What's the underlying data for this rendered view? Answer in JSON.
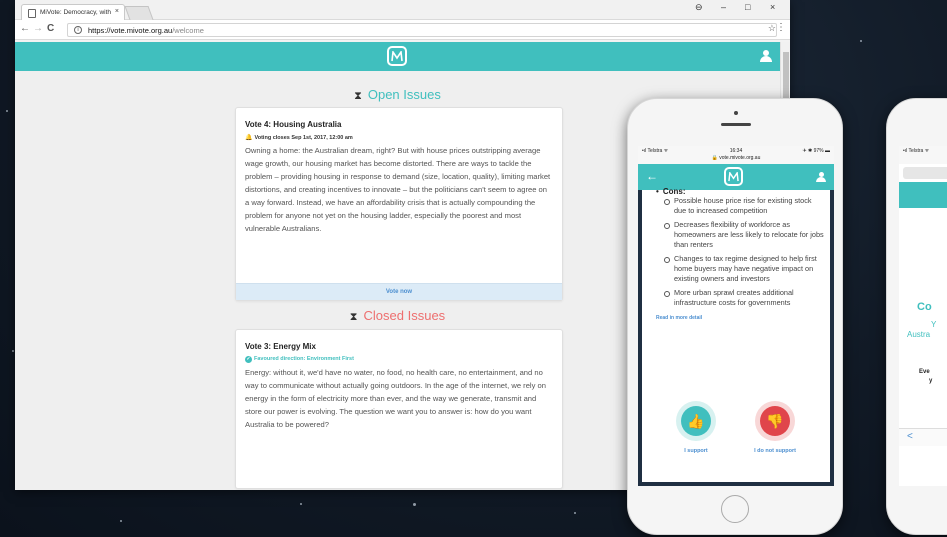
{
  "browser": {
    "tab_title": "MiVote: Democracy, with",
    "tab_close": "×",
    "window_controls": [
      "⊖",
      "–",
      "□",
      "×"
    ],
    "nav": {
      "back": "←",
      "forward": "→",
      "reload": "C"
    },
    "url_host": "https://vote.mivote.org.au",
    "url_path": "/welcome",
    "bookmark_icon": "☆",
    "menu_icon": "⋮"
  },
  "app": {
    "logo_icon": "mivote-logo",
    "user_icon": "user-icon",
    "accent_color": "#40bfbe",
    "danger_color": "#ee6f6f"
  },
  "open_issues": {
    "icon": "⧗",
    "title": "Open Issues",
    "card": {
      "title": "Vote 4: Housing Australia",
      "meta_icon": "bell-icon",
      "meta": "Voting closes Sep 1st, 2017, 12:00 am",
      "body": "Owning a home: the Australian dream, right? But with house prices outstripping average wage growth, our housing market has become distorted. There are ways to tackle the problem – providing housing in response to demand (size, location, quality), limiting market distortions, and creating incentives to innovate – but the politicians can't seem to agree on a way forward. Instead, we have an affordability crisis that is actually compounding the problem for anyone not yet on the housing ladder, especially the poorest and most vulnerable Australians.",
      "action": "Vote now"
    }
  },
  "closed_issues": {
    "icon": "⧗",
    "title": "Closed Issues",
    "card": {
      "title": "Vote 3: Energy Mix",
      "meta": "Favoured direction: Environment First",
      "body": "Energy: without it, we'd have no water, no food, no health care, no entertainment, and no way to communicate without actually going outdoors. In the age of the internet, we rely on energy in the form of electricity more than ever, and the way we generate, transmit and store our power is evolving. The question we want you to answer is: how do you want Australia to be powered?"
    }
  },
  "phone1": {
    "carrier": "•ıl Telstra ᯤ",
    "time": "16:34",
    "battery": "✈ ✱ 97% ▬",
    "url": "🔒 vote.mivote.org.au",
    "back": "←",
    "cons_heading": "Cons:",
    "cons": [
      "Possible house price rise for existing stock due to increased competition",
      "Decreases flexibility of workforce as homeowners are less likely to relocate for jobs than renters",
      "Changes to tax regime designed to help first home buyers may have negative impact on existing owners and investors",
      "More urban sprawl creates additional infrastructure costs for governments"
    ],
    "read_more": "Read in more detail",
    "support_label": "I support",
    "nosupport_label": "I do not support"
  },
  "phone2": {
    "carrier": "•ıl Telstra ᯤ",
    "text_large": "Co",
    "text_small_1": "Y",
    "text_small_2": "Austra",
    "text_dark_1": "Eve",
    "text_dark_2": "y",
    "back": "<"
  }
}
